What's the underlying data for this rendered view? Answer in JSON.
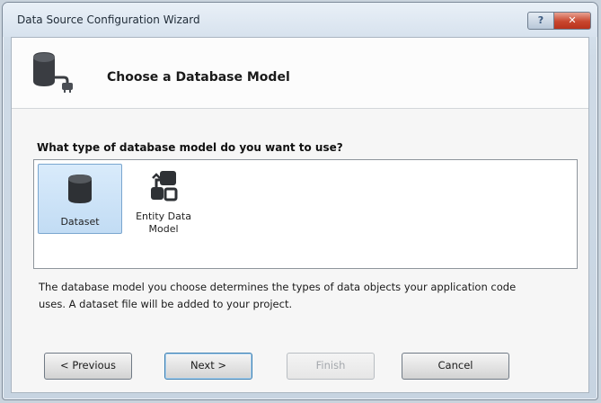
{
  "window": {
    "title": "Data Source Configuration Wizard",
    "help_label": "?",
    "close_label": "✕"
  },
  "header": {
    "title": "Choose a Database Model",
    "icon": "database-connection-icon"
  },
  "main": {
    "question": "What type of database model do you want to use?",
    "models": [
      {
        "label": "Dataset",
        "icon": "database-icon",
        "selected": true
      },
      {
        "label": "Entity Data Model",
        "icon": "entity-data-model-icon",
        "selected": false
      }
    ],
    "description": "The database model you choose determines the types of data objects your application code uses. A dataset file will be added to your project."
  },
  "buttons": {
    "previous": "< Previous",
    "next": "Next >",
    "finish": "Finish",
    "cancel": "Cancel"
  },
  "colors": {
    "selection": "#c9e0f6",
    "close_button": "#c8462e"
  }
}
